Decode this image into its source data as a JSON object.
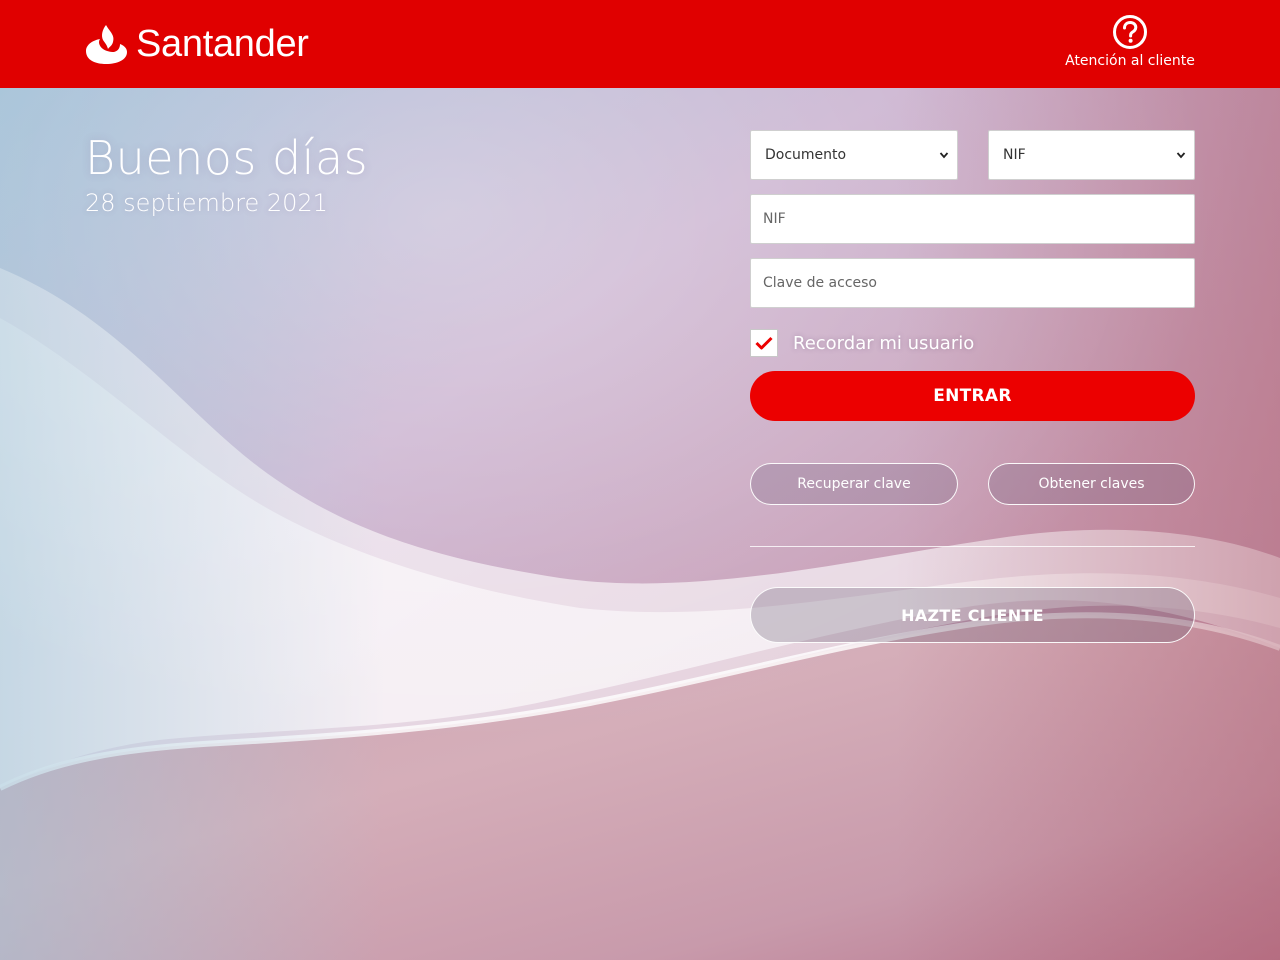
{
  "header": {
    "brand": "Santander",
    "help_label": "Atención al cliente",
    "background_color": "#e00000",
    "icons": {
      "logo": "flame-icon",
      "help": "question-circle-icon"
    }
  },
  "greeting": {
    "title": "Buenos días",
    "date": "28 septiembre 2021"
  },
  "login": {
    "document_select": {
      "selected": "Documento"
    },
    "type_select": {
      "selected": "NIF"
    },
    "user_input": {
      "placeholder": "NIF"
    },
    "password_input": {
      "placeholder": "Clave de acceso"
    },
    "remember": {
      "label": "Recordar mi usuario",
      "checked": true
    },
    "submit_label": "ENTRAR",
    "recover_label": "Recuperar clave",
    "obtain_label": "Obtener claves",
    "signup_label": "HAZTE CLIENTE"
  },
  "colors": {
    "brand_red": "#ec0000",
    "header_red": "#e00000"
  }
}
